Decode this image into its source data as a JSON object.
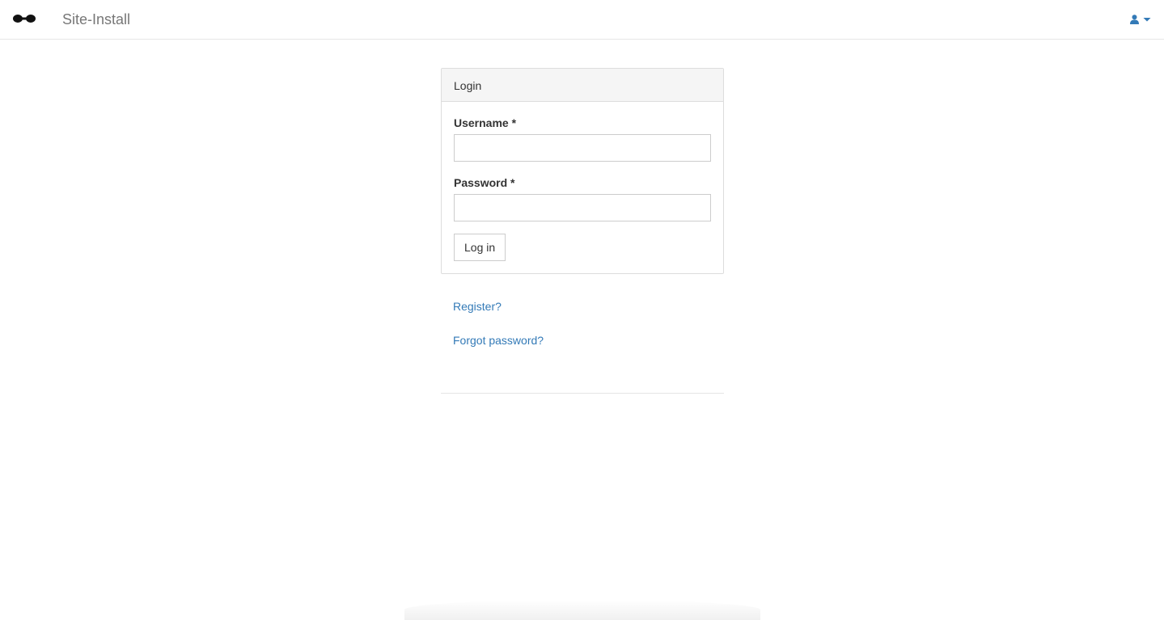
{
  "navbar": {
    "logo_icon": "bowtie-logo-icon",
    "title": "Site-Install",
    "user_menu_icon": "user-icon",
    "caret_icon": "caret-down-icon",
    "accent_color": "#337ab7"
  },
  "login_panel": {
    "heading": "Login",
    "username_label": "Username *",
    "username_value": "",
    "password_label": "Password *",
    "password_value": "",
    "submit_label": "Log in"
  },
  "links": {
    "register": "Register?",
    "forgot_password": "Forgot password?"
  }
}
